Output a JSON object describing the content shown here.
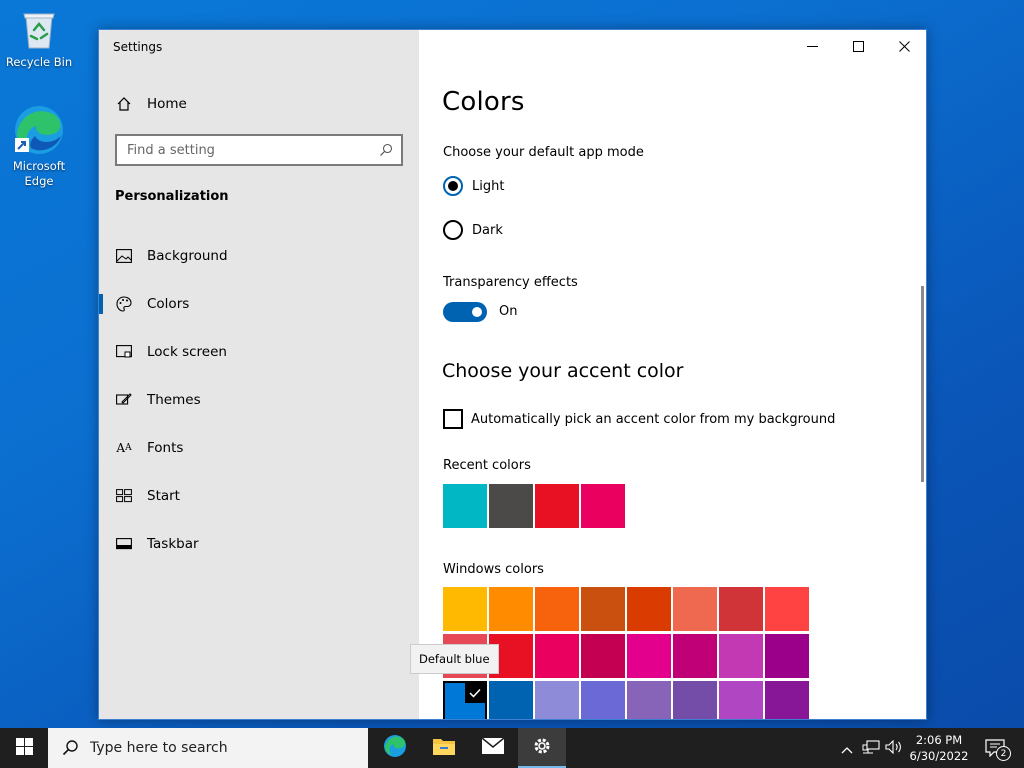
{
  "desktop": {
    "icons": [
      {
        "label": "Recycle Bin",
        "icon": "recycle-bin-icon"
      },
      {
        "label": "Microsoft Edge",
        "icon": "edge-icon"
      }
    ]
  },
  "window": {
    "title": "Settings",
    "controls": [
      "minimize-icon",
      "maximize-icon",
      "close-icon"
    ]
  },
  "sidebar": {
    "home_label": "Home",
    "search_placeholder": "Find a setting",
    "section_heading": "Personalization",
    "items": [
      {
        "label": "Background",
        "icon": "background-icon"
      },
      {
        "label": "Colors",
        "icon": "palette-icon",
        "active": true
      },
      {
        "label": "Lock screen",
        "icon": "lock-screen-icon"
      },
      {
        "label": "Themes",
        "icon": "themes-icon"
      },
      {
        "label": "Fonts",
        "icon": "fonts-icon"
      },
      {
        "label": "Start",
        "icon": "start-icon"
      },
      {
        "label": "Taskbar",
        "icon": "taskbar-icon"
      }
    ]
  },
  "content": {
    "title": "Colors",
    "app_mode_label": "Choose your default app mode",
    "app_mode_options": [
      {
        "label": "Light",
        "selected": true
      },
      {
        "label": "Dark",
        "selected": false
      }
    ],
    "transparency_label": "Transparency effects",
    "transparency_state": "On",
    "accent_heading": "Choose your accent color",
    "auto_pick_label": "Automatically pick an accent color from my background",
    "recent_colors_label": "Recent colors",
    "recent_colors": [
      "#00b7c3",
      "#4c4a48",
      "#e81123",
      "#ea005e"
    ],
    "windows_colors_label": "Windows colors",
    "windows_colors": [
      [
        "#ffb900",
        "#ff8c00",
        "#f7630c",
        "#ca5010",
        "#da3b01",
        "#ef6950",
        "#d13438",
        "#ff4343"
      ],
      [
        "#e74856",
        "#e81123",
        "#ea005e",
        "#c30052",
        "#e3008c",
        "#bf0077",
        "#c239b3",
        "#9a0089"
      ],
      [
        "#0078d7",
        "#0063b1",
        "#8e8cd8",
        "#6b69d6",
        "#8764b8",
        "#744da9",
        "#b146c2",
        "#881798"
      ]
    ],
    "selected_color": "#0078d7",
    "tooltip": "Default blue"
  },
  "taskbar": {
    "search_placeholder": "Type here to search",
    "apps": [
      "edge-icon",
      "file-explorer-icon",
      "mail-icon",
      "settings-gear-icon"
    ],
    "time": "2:06 PM",
    "date": "6/30/2022",
    "notification_count": "2"
  }
}
